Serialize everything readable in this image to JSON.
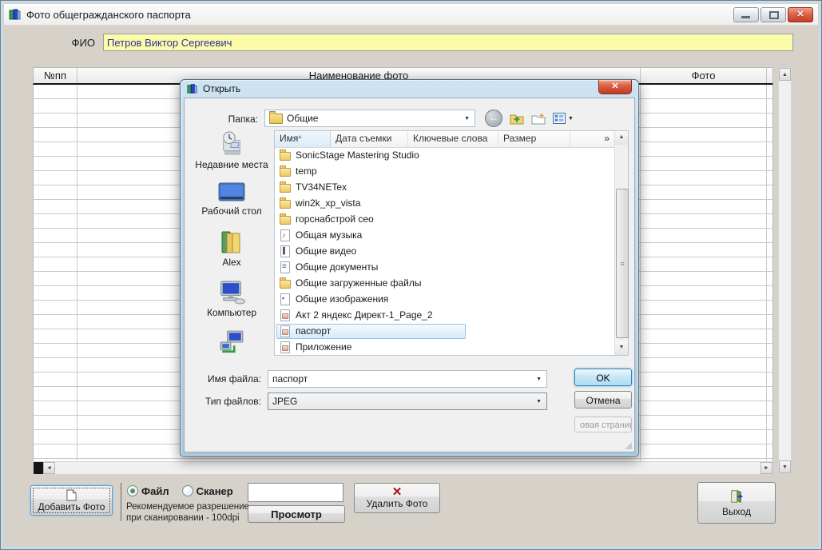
{
  "main_window": {
    "title": "Фото общегражданского паспорта",
    "fio": {
      "label": "ФИО",
      "value": "Петров Виктор Сергеевич"
    },
    "table": {
      "columns": [
        "№пп",
        "Наименование фото",
        "Фото"
      ]
    },
    "footer": {
      "add_photo_label": "Добавить Фото",
      "source_file_label": "Файл",
      "source_scanner_label": "Сканер",
      "hint_line1": "Рекомендуемое разрешение",
      "hint_line2": "при сканировании - 100dpi",
      "preview_value": "",
      "preview_label": "Просмотр",
      "delete_label": "Удалить Фото",
      "exit_label": "Выход"
    }
  },
  "open_dialog": {
    "title": "Открыть",
    "folder_label": "Папка:",
    "folder_value": "Общие",
    "sidebar": [
      {
        "label": "Недавние места"
      },
      {
        "label": "Рабочий стол"
      },
      {
        "label": "Alex"
      },
      {
        "label": "Компьютер"
      },
      {
        "label": ""
      }
    ],
    "columns": [
      "Имя",
      "Дата съемки",
      "Ключевые слова",
      "Размер",
      "»"
    ],
    "files": [
      {
        "name": "SonicStage Mastering Studio",
        "icon": "folder",
        "selected": false
      },
      {
        "name": "temp",
        "icon": "folder",
        "selected": false
      },
      {
        "name": "TV34NETex",
        "icon": "folder",
        "selected": false
      },
      {
        "name": "win2k_xp_vista",
        "icon": "folder",
        "selected": false
      },
      {
        "name": "горснабстрой сео",
        "icon": "folder",
        "selected": false
      },
      {
        "name": "Общая музыка",
        "icon": "page-music",
        "selected": false
      },
      {
        "name": "Общие видео",
        "icon": "page-video",
        "selected": false
      },
      {
        "name": "Общие документы",
        "icon": "page-doc",
        "selected": false
      },
      {
        "name": "Общие загруженные файлы",
        "icon": "folder",
        "selected": false
      },
      {
        "name": "Общие изображения",
        "icon": "page-pics",
        "selected": false
      },
      {
        "name": "Акт 2 яндекс Директ-1_Page_2",
        "icon": "image",
        "selected": false
      },
      {
        "name": "паспорт",
        "icon": "image",
        "selected": true
      },
      {
        "name": "Приложение",
        "icon": "image",
        "selected": false
      }
    ],
    "filename_label": "Имя файла:",
    "filename_value": "паспорт",
    "filetype_label": "Тип файлов:",
    "filetype_value": "JPEG",
    "ok_label": "OK",
    "cancel_label": "Отмена",
    "extra_label": "овая страниц",
    "accent_colors": {
      "selection_border": "#94c4e8",
      "default_button_border": "#3c7fb1",
      "fio_background": "#fbfbaa"
    }
  }
}
